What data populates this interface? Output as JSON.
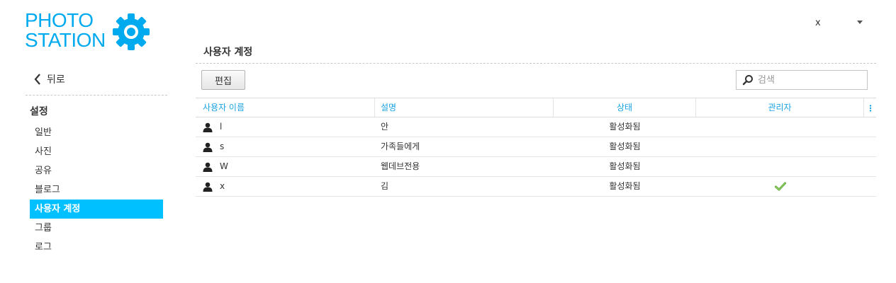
{
  "logo": {
    "line1": "PHOTO",
    "line2": "STATION"
  },
  "colors": {
    "accent": "#00c0ff",
    "logo": "#00aaee",
    "header_text": "#1aa3e0",
    "check": "#5aa836"
  },
  "user_menu": {
    "username": "x"
  },
  "sidebar": {
    "back_label": "뒤로",
    "section_title": "설정",
    "items": [
      {
        "label": "일반"
      },
      {
        "label": "사진"
      },
      {
        "label": "공유"
      },
      {
        "label": "블로그"
      },
      {
        "label": "사용자 계정",
        "active": true
      },
      {
        "label": "그룹"
      },
      {
        "label": "로그"
      }
    ]
  },
  "main": {
    "title": "사용자 계정",
    "edit_label": "편집",
    "search_placeholder": "검색",
    "columns": {
      "name": "사용자 이름",
      "description": "설명",
      "status": "상태",
      "admin": "관리자"
    },
    "rows": [
      {
        "name": "l",
        "description": "안",
        "status": "활성화됨",
        "admin": false
      },
      {
        "name": "s",
        "description": "가족들에게",
        "status": "활성화됨",
        "admin": false
      },
      {
        "name": "W",
        "description": "웹데브전용",
        "status": "활성화됨",
        "admin": false
      },
      {
        "name": "x",
        "description": "김",
        "status": "활성화됨",
        "admin": true
      }
    ]
  }
}
